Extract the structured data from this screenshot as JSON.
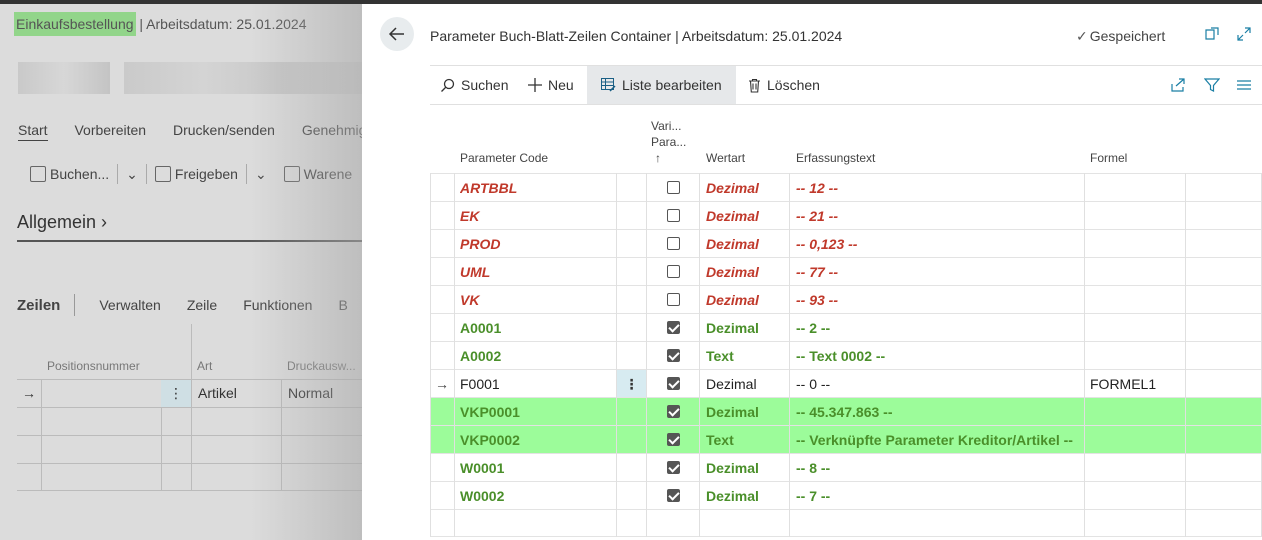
{
  "background": {
    "title_highlight": "Einkaufsbestellung",
    "title_rest": " | Arbeitsdatum: 25.01.2024",
    "tabs": [
      "Start",
      "Vorbereiten",
      "Drucken/senden",
      "Genehmig"
    ],
    "actions": {
      "post": "Buchen...",
      "release": "Freigeben",
      "warehouse": "Warene"
    },
    "section_general": "Allgemein",
    "lines": {
      "title": "Zeilen",
      "manage": "Verwalten",
      "line": "Zeile",
      "functions": "Funktionen",
      "more": "B"
    },
    "grid_headers": [
      "Positionsnummer",
      "Art",
      "Druckausw..."
    ],
    "grid_row": {
      "type": "Artikel",
      "print": "Normal"
    }
  },
  "dialog": {
    "title": "Parameter Buch-Blatt-Zeilen Container | Arbeitsdatum: 25.01.2024",
    "saved_label": "Gespeichert",
    "toolbar": {
      "search": "Suchen",
      "new": "Neu",
      "edit_list": "Liste bearbeiten",
      "delete": "Löschen"
    },
    "columns": {
      "code": "Parameter Code",
      "vari_1": "Vari...",
      "vari_2": "Para...",
      "sort_arrow": "↑",
      "value_type": "Wertart",
      "entry_text": "Erfassungstext",
      "formula": "Formel"
    },
    "rows": [
      {
        "code": "ARTBBL",
        "checked": false,
        "type": "Dezimal",
        "text": "-- 12 --",
        "formula": "",
        "style": "red"
      },
      {
        "code": "EK",
        "checked": false,
        "type": "Dezimal",
        "text": "-- 21 --",
        "formula": "",
        "style": "red"
      },
      {
        "code": "PROD",
        "checked": false,
        "type": "Dezimal",
        "text": "-- 0,123 --",
        "formula": "",
        "style": "red"
      },
      {
        "code": "UML",
        "checked": false,
        "type": "Dezimal",
        "text": "-- 77 --",
        "formula": "",
        "style": "red"
      },
      {
        "code": "VK",
        "checked": false,
        "type": "Dezimal",
        "text": "-- 93 --",
        "formula": "",
        "style": "red"
      },
      {
        "code": "A0001",
        "checked": true,
        "type": "Dezimal",
        "text": "-- 2 --",
        "formula": "",
        "style": "green"
      },
      {
        "code": "A0002",
        "checked": true,
        "type": "Text",
        "text": "-- Text 0002 --",
        "formula": "",
        "style": "green"
      },
      {
        "code": "F0001",
        "checked": true,
        "type": "Dezimal",
        "text": "-- 0 --",
        "formula": "FORMEL1",
        "style": "plain",
        "selected": true
      },
      {
        "code": "VKP0001",
        "checked": true,
        "type": "Dezimal",
        "text": "-- 45.347.863 --",
        "formula": "",
        "style": "green",
        "highlight": true
      },
      {
        "code": "VKP0002",
        "checked": true,
        "type": "Text",
        "text": "-- Verknüpfte Parameter Kreditor/Artikel --",
        "formula": "",
        "style": "green",
        "highlight": true
      },
      {
        "code": "W0001",
        "checked": true,
        "type": "Dezimal",
        "text": "-- 8 --",
        "formula": "",
        "style": "green"
      },
      {
        "code": "W0002",
        "checked": true,
        "type": "Dezimal",
        "text": "-- 7 --",
        "formula": "",
        "style": "green"
      }
    ]
  },
  "colors": {
    "red": "#c0392b",
    "green": "#4a8f2a",
    "highlight": "#9cfc9a",
    "accent": "#1a7fa5"
  }
}
